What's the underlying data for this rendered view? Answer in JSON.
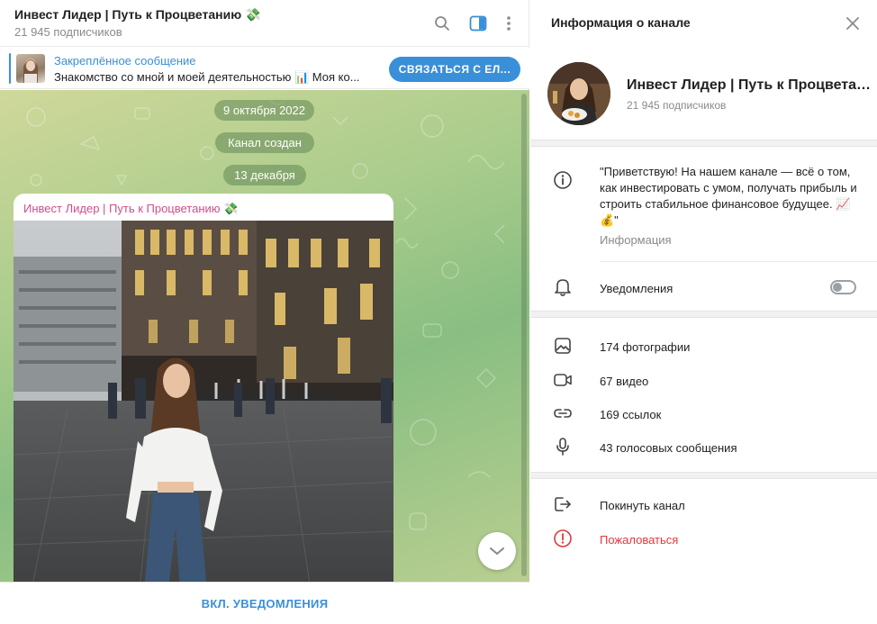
{
  "chat": {
    "title": "Инвест Лидер | Путь к Процветанию 💸",
    "subscribers": "21 945 подписчиков",
    "icons": [
      "search-icon",
      "sidebar-toggle-icon",
      "more-vertical-icon"
    ],
    "pinned": {
      "label": "Закреплённое сообщение",
      "text": "Знакомство со мной и моей деятельностью 📊 Моя ко...",
      "button": "СВЯЗАТЬСЯ С ЕЛ..."
    },
    "dates": {
      "first": "9 октября 2022",
      "created": "Канал создан",
      "second": "13 декабря"
    },
    "message": {
      "author": "Инвест Лидер | Путь к Процветанию 💸"
    },
    "footer_button": "ВКЛ. УВЕДОМЛЕНИЯ"
  },
  "info": {
    "title": "Информация о канале",
    "channel_name": "Инвест Лидер | Путь к Процветанию 💸",
    "subscribers": "21 945 подписчиков",
    "description": "\"Приветствую! На нашем канале — всё о том, как инвестировать с умом, получать прибыль и строить стабильное финансовое будущее. 📈 💰\"",
    "description_caption": "Информация",
    "notifications_label": "Уведомления",
    "notifications_enabled": false,
    "media": [
      {
        "icon": "photo-icon",
        "label": "174 фотографии"
      },
      {
        "icon": "video-icon",
        "label": "67 видео"
      },
      {
        "icon": "link-icon",
        "label": "169 ссылок"
      },
      {
        "icon": "microphone-icon",
        "label": "43 голосовых сообщения"
      }
    ],
    "leave_label": "Покинуть канал",
    "report_label": "Пожаловаться"
  },
  "colors": {
    "accent": "#3a8fd9",
    "author": "#d14d8a",
    "danger": "#e0393e"
  }
}
